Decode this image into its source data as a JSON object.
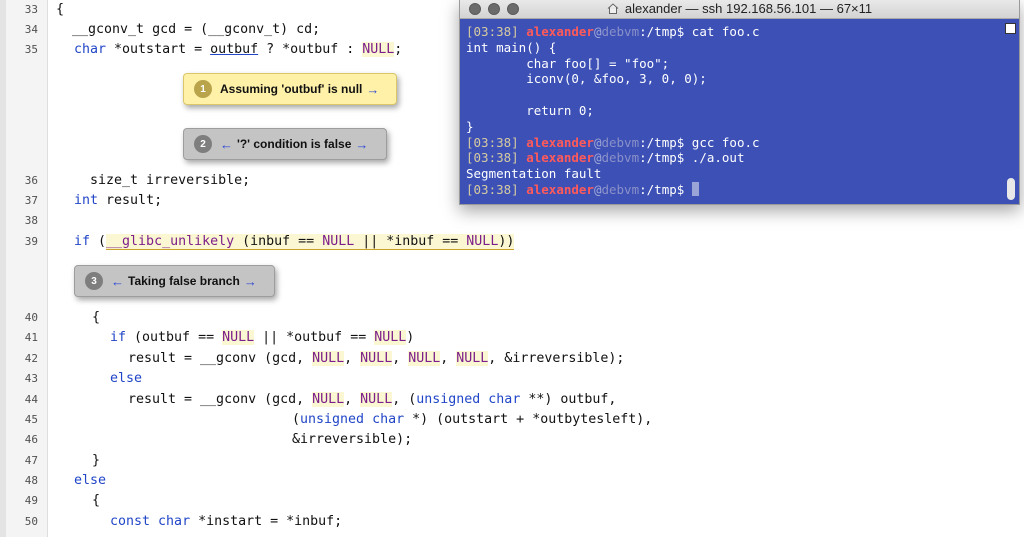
{
  "editor": {
    "lines": [
      {
        "n": "33"
      },
      {
        "n": "34"
      },
      {
        "n": "35"
      },
      {
        "n": "36"
      },
      {
        "n": "37"
      },
      {
        "n": "38"
      },
      {
        "n": "39"
      },
      {
        "n": "40"
      },
      {
        "n": "41"
      },
      {
        "n": "42"
      },
      {
        "n": "43"
      },
      {
        "n": "44"
      },
      {
        "n": "45"
      },
      {
        "n": "46"
      },
      {
        "n": "47"
      },
      {
        "n": "48"
      },
      {
        "n": "49"
      },
      {
        "n": "50"
      }
    ],
    "code": {
      "l33": "{",
      "l34": "  __gconv_t gcd = (__gconv_t) cd;",
      "l35_kw": "char",
      "l35_a": " *outstart = ",
      "l35_var": "outbuf",
      "l35_b": " ? *outbuf : ",
      "l35_null": "NULL",
      "l35_c": ";",
      "l36": "  size_t irreversible;",
      "l37_kw": "int",
      "l37_a": " result;",
      "l39_kw": "if",
      "l39_a": " (",
      "l39_mac": "__glibc_unlikely",
      "l39_b": " (inbuf == ",
      "l39_null1": "NULL",
      "l39_c": " || *inbuf == ",
      "l39_null2": "NULL",
      "l39_d": "))",
      "l40": "{",
      "l41_kw": "if",
      "l41_a": " (outbuf == ",
      "l41_null1": "NULL",
      "l41_b": " || *outbuf == ",
      "l41_null2": "NULL",
      "l41_c": ")",
      "l42_a": "result = __gconv (gcd, ",
      "l42_n1": "NULL",
      "l42_b": ", ",
      "l42_n2": "NULL",
      "l42_c": ", ",
      "l42_n3": "NULL",
      "l42_d": ", ",
      "l42_n4": "NULL",
      "l42_e": ", &irreversible);",
      "l43_kw": "else",
      "l44_a": "result = __gconv (gcd, ",
      "l44_n1": "NULL",
      "l44_b": ", ",
      "l44_n2": "NULL",
      "l44_c": ", (",
      "l44_kw1": "unsigned",
      "l44_d": " ",
      "l44_kw2": "char",
      "l44_e": " **) outbuf,",
      "l45_a": "(",
      "l45_kw1": "unsigned",
      "l45_b": " ",
      "l45_kw2": "char",
      "l45_c": " *) (outstart + *outbytesleft),",
      "l46": "&irreversible);",
      "l47": "}",
      "l48_kw": "else",
      "l49": "{",
      "l50_kw1": "const",
      "l50_a": " ",
      "l50_kw2": "char",
      "l50_b": " *instart = *inbuf;"
    },
    "events": [
      {
        "num": "1",
        "label": "Assuming 'outbuf' is null",
        "right": "→"
      },
      {
        "num": "2",
        "left": "←",
        "label": "'?' condition is false",
        "right": "→"
      },
      {
        "num": "3",
        "left": "←",
        "label": "Taking false branch",
        "right": "→"
      }
    ]
  },
  "terminal": {
    "title": "alexander — ssh 192.168.56.101 — 67×11",
    "icon": "home-folder-icon",
    "bg": "#3c50b6",
    "prompt_time": "[03:38]",
    "prompt_user": "alexander",
    "prompt_at": "@",
    "prompt_host": "debvm",
    "prompt_path1": ":/tmp$ cat foo.c",
    "prompt_path2": ":/tmp$ gcc foo.c",
    "prompt_path3": ":/tmp$ ./a.out",
    "prompt_path4": ":/tmp$ ",
    "out1": "int main() {",
    "out2": "        char foo[] = \"foo\";",
    "out3": "        iconv(0, &foo, 3, 0, 0);",
    "out4": "",
    "out5": "        return 0;",
    "out6": "}",
    "out7": "Segmentation fault"
  }
}
